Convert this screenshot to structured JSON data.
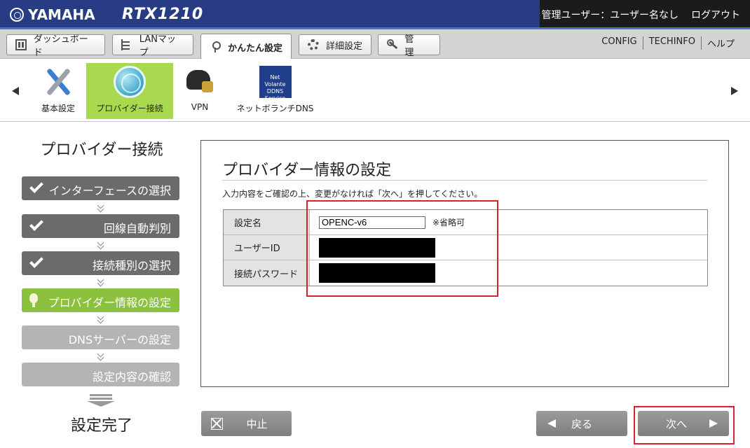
{
  "header": {
    "brand": "YAMAHA",
    "model": "RTX1210",
    "user_label": "管理ユーザー：ユーザー名なし",
    "logout": "ログアウト"
  },
  "tabs": [
    {
      "label": "ダッシュボード",
      "icon": "dashboard-icon"
    },
    {
      "label": "LANマップ",
      "icon": "lan-map-icon"
    },
    {
      "label": "かんたん設定",
      "icon": "pin-icon",
      "active": true
    },
    {
      "label": "詳細設定",
      "icon": "gear-icon"
    },
    {
      "label": "管　理",
      "icon": "wrench-icon"
    }
  ],
  "top_links": [
    "CONFIG",
    "TECHINFO",
    "ヘルプ"
  ],
  "icon_strip": [
    {
      "label": "基本設定",
      "icon": "tools-icon"
    },
    {
      "label": "プロバイダー接続",
      "icon": "globe-icon",
      "active": true
    },
    {
      "label": "VPN",
      "icon": "vpn-lock-icon"
    },
    {
      "label": "ネットボランチDNS",
      "icon": "ddns-icon",
      "badge_text": "Net Volante DDNS Service"
    }
  ],
  "sidebar": {
    "title": "プロバイダー接続",
    "steps": [
      {
        "label": "インターフェースの選択",
        "state": "done"
      },
      {
        "label": "回線自動判別",
        "state": "done"
      },
      {
        "label": "接続種別の選択",
        "state": "done"
      },
      {
        "label": "プロバイダー情報の設定",
        "state": "current"
      },
      {
        "label": "DNSサーバーの設定",
        "state": "future"
      },
      {
        "label": "設定内容の確認",
        "state": "future"
      }
    ],
    "finish": "設定完了"
  },
  "main": {
    "title": "プロバイダー情報の設定",
    "description": "入力内容をご確認の上、変更がなければ「次へ」を押してください。",
    "fields": [
      {
        "label": "設定名",
        "value": "OPENC-v6",
        "note": "※省略可"
      },
      {
        "label": "ユーザーID",
        "value": ""
      },
      {
        "label": "接続パスワード",
        "value": ""
      }
    ]
  },
  "buttons": {
    "cancel": "中止",
    "back": "戻る",
    "next": "次へ"
  },
  "colors": {
    "header_bg": "#283c86",
    "active_green": "#8bc13e",
    "highlight_red": "#d9232a"
  }
}
